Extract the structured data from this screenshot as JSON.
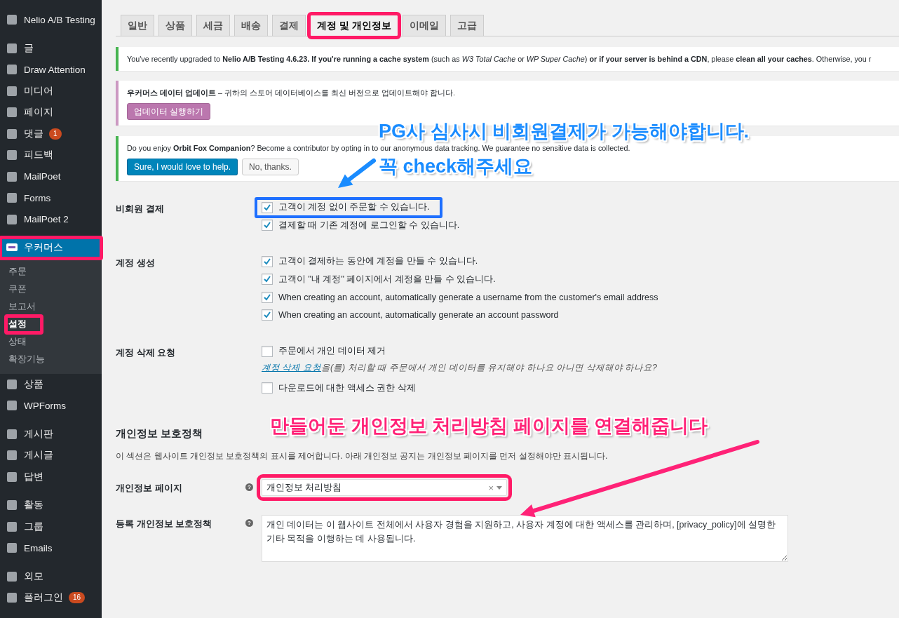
{
  "sidebar": {
    "groups": [
      {
        "items": [
          {
            "label": "Nelio A/B Testing",
            "current": false,
            "highlighted": false
          }
        ]
      },
      {
        "items": [
          {
            "label": "글",
            "current": false,
            "highlighted": false
          },
          {
            "label": "Draw Attention",
            "current": false,
            "highlighted": false
          },
          {
            "label": "미디어",
            "current": false,
            "highlighted": false
          },
          {
            "label": "페이지",
            "current": false,
            "highlighted": false
          },
          {
            "label": "댓글",
            "badge": "1",
            "current": false,
            "highlighted": false
          },
          {
            "label": "피드백",
            "current": false,
            "highlighted": false
          },
          {
            "label": "MailPoet",
            "current": false,
            "highlighted": false
          },
          {
            "label": "Forms",
            "current": false,
            "highlighted": false
          },
          {
            "label": "MailPoet 2",
            "current": false,
            "highlighted": false
          }
        ]
      },
      {
        "items": [
          {
            "label": "우커머스",
            "current": true,
            "highlighted": true,
            "children": [
              {
                "label": "주문",
                "selected": false,
                "highlighted": false
              },
              {
                "label": "쿠폰",
                "selected": false,
                "highlighted": false
              },
              {
                "label": "보고서",
                "selected": false,
                "highlighted": false
              },
              {
                "label": "설정",
                "selected": true,
                "highlighted": true
              },
              {
                "label": "상태",
                "selected": false,
                "highlighted": false
              },
              {
                "label": "확장기능",
                "selected": false,
                "highlighted": false
              }
            ]
          },
          {
            "label": "상품",
            "current": false,
            "highlighted": false
          },
          {
            "label": "WPForms",
            "current": false,
            "highlighted": false
          }
        ]
      },
      {
        "items": [
          {
            "label": "게시판",
            "current": false,
            "highlighted": false
          },
          {
            "label": "게시글",
            "current": false,
            "highlighted": false
          },
          {
            "label": "답변",
            "current": false,
            "highlighted": false
          }
        ]
      },
      {
        "items": [
          {
            "label": "활동",
            "current": false,
            "highlighted": false
          },
          {
            "label": "그룹",
            "current": false,
            "highlighted": false
          },
          {
            "label": "Emails",
            "current": false,
            "highlighted": false
          }
        ]
      },
      {
        "items": [
          {
            "label": "외모",
            "current": false,
            "highlighted": false
          },
          {
            "label": "플러그인",
            "badge": "16",
            "current": false,
            "highlighted": false
          }
        ]
      }
    ]
  },
  "tabs": [
    {
      "label": "일반",
      "selected": false,
      "highlighted": false
    },
    {
      "label": "상품",
      "selected": false,
      "highlighted": false
    },
    {
      "label": "세금",
      "selected": false,
      "highlighted": false
    },
    {
      "label": "배송",
      "selected": false,
      "highlighted": false
    },
    {
      "label": "결제",
      "selected": false,
      "highlighted": false
    },
    {
      "label": "계정 및 개인정보",
      "selected": true,
      "highlighted": true
    },
    {
      "label": "이메일",
      "selected": false,
      "highlighted": false
    },
    {
      "label": "고급",
      "selected": false,
      "highlighted": false
    }
  ],
  "notices": [
    {
      "kind": "success",
      "text": "You've recently upgraded to **Nelio A/B Testing 4.6.23. If you're running a cache system** (such as *W3 Total Cache* or *WP Super Cache*) **or if your server is behind a CDN**, please **clean all your caches**. Otherwise, you r"
    },
    {
      "kind": "woo",
      "text": "**우커머스 데이터 업데이트** – 귀하의 스토어 데이터베이스를 최신 버전으로 업데이트해야 합니다.",
      "buttons": [
        {
          "label": "업데이터 실행하기",
          "kind": "woo"
        }
      ]
    },
    {
      "kind": "success",
      "text": "Do you enjoy **Orbit Fox Companion**? Become a contributor by opting in to our anonymous data tracking. We guarantee no sensitive data is collected.",
      "buttons": [
        {
          "label": "Sure, I would love to help.",
          "kind": "primary"
        },
        {
          "label": "No, thanks.",
          "kind": "secondary"
        }
      ]
    }
  ],
  "form": {
    "rows": [
      {
        "kind": "checkboxes",
        "label": "비회원 결제",
        "options": [
          {
            "label": "고객이 계정 없이 주문할 수 있습니다.",
            "checked": true,
            "highlighted": true
          },
          {
            "label": "결제할 때 기존 계정에 로그인할 수 있습니다.",
            "checked": true,
            "highlighted": false
          }
        ]
      },
      {
        "kind": "checkboxes",
        "label": "계정 생성",
        "options": [
          {
            "label": "고객이 결제하는 동안에 계정을 만들 수 있습니다.",
            "checked": true,
            "highlighted": false
          },
          {
            "label": "고객이 \"내 계정\" 페이지에서 계정을 만들 수 있습니다.",
            "checked": true,
            "highlighted": false
          },
          {
            "label": "When creating an account, automatically generate a username from the customer's email address",
            "checked": true,
            "highlighted": false
          },
          {
            "label": "When creating an account, automatically generate an account password",
            "checked": true,
            "highlighted": false
          }
        ]
      },
      {
        "kind": "checkboxes",
        "label": "계정 삭제 요청",
        "options": [
          {
            "label": "주문에서 개인 데이터 제거",
            "checked": false,
            "highlighted": false,
            "link": "계정 삭제 요청",
            "description": "을(를) 처리할 때 주문에서 개인 데이터를 유지해야 하나요 아니면 삭제해야 하나요?"
          },
          {
            "label": "다운로드에 대한 액세스 권한 삭제",
            "checked": false,
            "highlighted": false
          }
        ]
      },
      {
        "kind": "section",
        "title": "개인정보 보호정책",
        "description": "이 섹션은 웹사이트 개인정보 보호정책의 표시를 제어합니다. 아래 개인정보 공지는 개인정보 페이지를 먼저 설정해야만 표시됩니다."
      },
      {
        "kind": "select",
        "label": "개인정보 페이지",
        "help": "?",
        "value": "개인정보 처리방침",
        "clear": "×",
        "highlighted": true
      },
      {
        "kind": "textarea",
        "label": "등록 개인정보 보호정책",
        "help": "?",
        "value": "개인 데이터는 이 웹사이트 전체에서 사용자 경험을 지원하고, 사용자 계정에 대한 액세스를 관리하며, [privacy_policy]에 설명한 기타 목적을 이행하는 데 사용됩니다."
      }
    ]
  },
  "annotations": [
    {
      "color": "#1a8cff",
      "lines": [
        "PG사 심사시 비회원결제가 가능해야합니다.",
        "꼭 check해주세요"
      ]
    },
    {
      "color": "#ff2277",
      "lines": [
        "만들어둔 개인정보 처리방침 페이지를 연결해줍니다"
      ]
    }
  ]
}
